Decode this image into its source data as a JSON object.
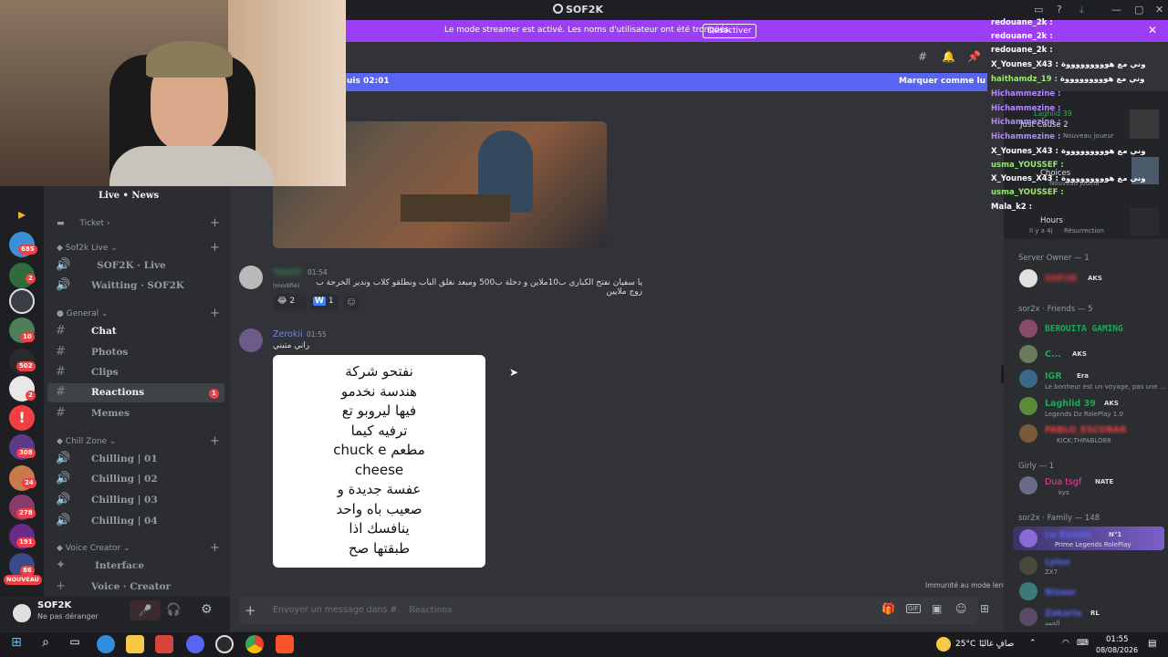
{
  "app": {
    "title": "SOF2K"
  },
  "banner": {
    "text": "Le mode streamer est activé. Les noms d'utilisateur ont été tronqués.",
    "button": "Désactiver"
  },
  "server_rail": {
    "badges": [
      "685",
      "2",
      "10",
      "502",
      "2",
      "308",
      "24",
      "278",
      "191",
      "86"
    ],
    "new_label": "NOUVEAU"
  },
  "sidebar": {
    "top_channel": "Live • News",
    "categories": {
      "ticket": "Ticket",
      "sof2k_live": "Sof2k Live",
      "general": "General",
      "chill_zone": "Chill Zone",
      "voice_creator": "Voice Creator"
    },
    "channels": {
      "live": "SOF2K · Live",
      "waitting": "Waitting · SOF2K",
      "chat": "Chat",
      "photos": "Photos",
      "clips": "Clips",
      "reactions": "Reactions",
      "memes": "Memes",
      "chilling1": "Chilling | 01",
      "chilling2": "Chilling | 02",
      "chilling3": "Chilling | 03",
      "chilling4": "Chilling | 04",
      "interface": "Interface",
      "voice_creator": "Voice · Creator"
    },
    "reactions_badge": "1"
  },
  "user": {
    "name": "SOF2K",
    "status": "Ne pas déranger"
  },
  "chat": {
    "unread_left": "uis 02:01",
    "unread_right": "Marquer comme lu",
    "messages": [
      {
        "author": "Yassiin",
        "time": "01:54",
        "text": "يا سفيان نفتح الكباري ب10ملاين و دخلة ب500 ومبعد نغلق الباب ونطلقو كلاب وندير الخرجة ب زوج ملايين",
        "edited": "(modifié)",
        "reactions": [
          {
            "emoji": "😂",
            "count": "2"
          },
          {
            "emoji": "W",
            "count": "1"
          }
        ]
      },
      {
        "author": "Zerokii",
        "time": "01:55",
        "text": "راني متبني",
        "card_lines": [
          "نفتحو شركة",
          "هندسة  نخدمو",
          "فيها ليروبو تع",
          "ترفيه كيما",
          "chuck e  مطعم",
          "cheese",
          "عفسة جديدة و",
          "صعيب باه واحد",
          "ينافسك اذا",
          "طبقتها صح"
        ]
      }
    ],
    "input_placeholder": "Envoyer un message dans #",
    "input_channel": "Reactions",
    "slowmode": "Immunité au mode lent"
  },
  "twitch_chat": [
    {
      "user": "redouane_2k :",
      "color": "#ffffff"
    },
    {
      "user": "redouane_2k :",
      "color": "#ffffff"
    },
    {
      "user": "redouane_2k :",
      "color": "#ffffff"
    },
    {
      "user": "X_Younes_X43 :",
      "msg": "وني مع هوووووووووة",
      "color": "#ffffff"
    },
    {
      "user": "haithamdz_19 :",
      "msg": "وني مع هوووووووووة",
      "color": "#9be870"
    },
    {
      "user": "Hichammezine :",
      "color": "#b388ff"
    },
    {
      "user": "Hichammezine :",
      "color": "#b388ff"
    },
    {
      "user": "Hichammezine :",
      "color": "#b388ff"
    },
    {
      "user": "Hichammezine :",
      "color": "#b388ff"
    },
    {
      "user": "X_Younes_X43 :",
      "msg": "وني مع هوووووووووة",
      "color": "#ffffff"
    },
    {
      "user": "usma_YOUSSEF :",
      "color": "#9be870"
    },
    {
      "user": "X_Younes_X43 :",
      "msg": "وني مع هوووووووووة",
      "color": "#ffffff"
    },
    {
      "user": "usma_YOUSSEF :",
      "color": "#9be870"
    },
    {
      "user": "Mala_k2 :",
      "color": "#ffffff"
    }
  ],
  "activity": {
    "a1": "Laghlid 39",
    "a2": "Just Cause 2",
    "a3": "Nouveau joueur",
    "a4": "Choices",
    "a5": "Nouveau joueur",
    "a6": "Hours",
    "a7": "Il y a 4j",
    "a8": "Résurrection"
  },
  "members": {
    "owner_header": "Server Owner — 1",
    "owner": {
      "name": "SOF2K",
      "tag": "AKS"
    },
    "friends_header": "sor2x · Friends — 5",
    "friends": [
      {
        "name": "BEROUITA GAMING",
        "color": "#23a55a"
      },
      {
        "name": "C...",
        "tag": "AKS",
        "color": "#23a55a"
      },
      {
        "name": "IGR",
        "tag": "Era",
        "sub": "Le bonheur est un voyage, pas une ...",
        "color": "#23a55a"
      },
      {
        "name": "Laghlid 39",
        "tag": "AKS",
        "sub": "Legends Dz RolePlay 1.0",
        "color": "#23a55a"
      },
      {
        "name": "PABLO_ESCOBAR",
        "sub": "KICK:THPABLO88",
        "color": "#f23f43"
      }
    ],
    "girly_header": "Girly — 1",
    "girly": {
      "name": "Dua tsgf",
      "tag": "NATE",
      "sub": "kys",
      "color": "#eb459e"
    },
    "family_header": "sor2x · Family — 148",
    "family": [
      {
        "name": "Le Bandit",
        "tag": "N°1",
        "sub": "Prime Legends RolePlay",
        "color": "#5865f2"
      },
      {
        "name": "Lyloo",
        "sub": "ZX7",
        "color": "#5865f2"
      },
      {
        "name": "Nizaar",
        "color": "#5865f2"
      },
      {
        "name": "Zakaria",
        "tag": "RL",
        "sub": "الحمد",
        "color": "#5865f2"
      }
    ]
  },
  "taskbar": {
    "weather": "25°C",
    "weather_text": "صافٍ غالبًا",
    "time": "01:55",
    "date": "08/08/2026"
  }
}
